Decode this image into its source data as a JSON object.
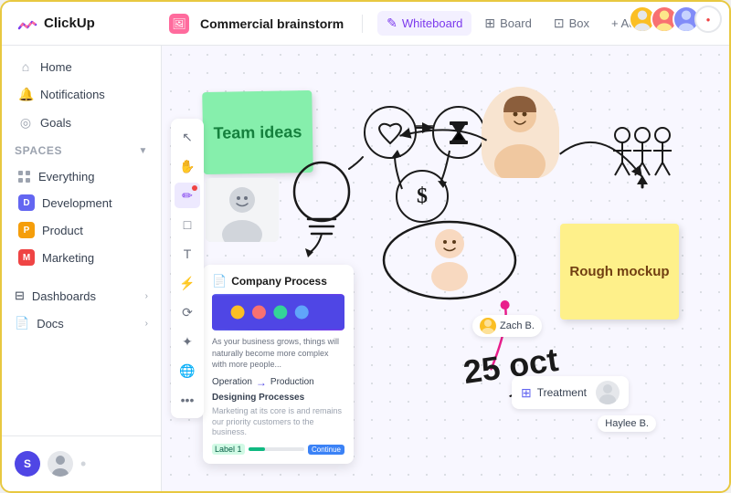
{
  "app": {
    "name": "ClickUp"
  },
  "topbar": {
    "page_title": "Commercial brainstorm",
    "tabs": [
      {
        "id": "whiteboard",
        "label": "Whiteboard",
        "active": true,
        "icon": "✎"
      },
      {
        "id": "board",
        "label": "Board",
        "active": false,
        "icon": "⊞"
      },
      {
        "id": "box",
        "label": "Box",
        "active": false,
        "icon": "⊡"
      }
    ],
    "add_view_label": "+ Add view"
  },
  "sidebar": {
    "nav_items": [
      {
        "id": "home",
        "label": "Home",
        "icon": "⌂"
      },
      {
        "id": "notifications",
        "label": "Notifications",
        "icon": "🔔"
      },
      {
        "id": "goals",
        "label": "Goals",
        "icon": "◎"
      }
    ],
    "spaces_label": "Spaces",
    "space_items": [
      {
        "id": "everything",
        "label": "Everything",
        "icon_text": "everything",
        "color": "#9ca3af"
      },
      {
        "id": "development",
        "label": "Development",
        "badge": "D",
        "color": "#6366f1"
      },
      {
        "id": "product",
        "label": "Product",
        "badge": "P",
        "color": "#f59e0b"
      },
      {
        "id": "marketing",
        "label": "Marketing",
        "badge": "M",
        "color": "#ef4444"
      }
    ],
    "bottom_items": [
      {
        "id": "dashboards",
        "label": "Dashboards"
      },
      {
        "id": "docs",
        "label": "Docs"
      }
    ],
    "user_initial": "S"
  },
  "canvas": {
    "sticky_team_ideas": "Team ideas",
    "sticky_rough_mockup": "Rough mockup",
    "process_card": {
      "title": "Company Process",
      "subtitle": "Designing Processes",
      "operation_label": "Operation",
      "production_label": "Production",
      "description_short": "As your business grows, things will naturally become more complex with more people...",
      "description_designing": "Marketing at its core is and remains our priority customers to the business."
    },
    "zach_label": "Zach B.",
    "date_text": "25 oct",
    "treatment_label": "Treatment",
    "haylee_label": "Haylee B."
  }
}
